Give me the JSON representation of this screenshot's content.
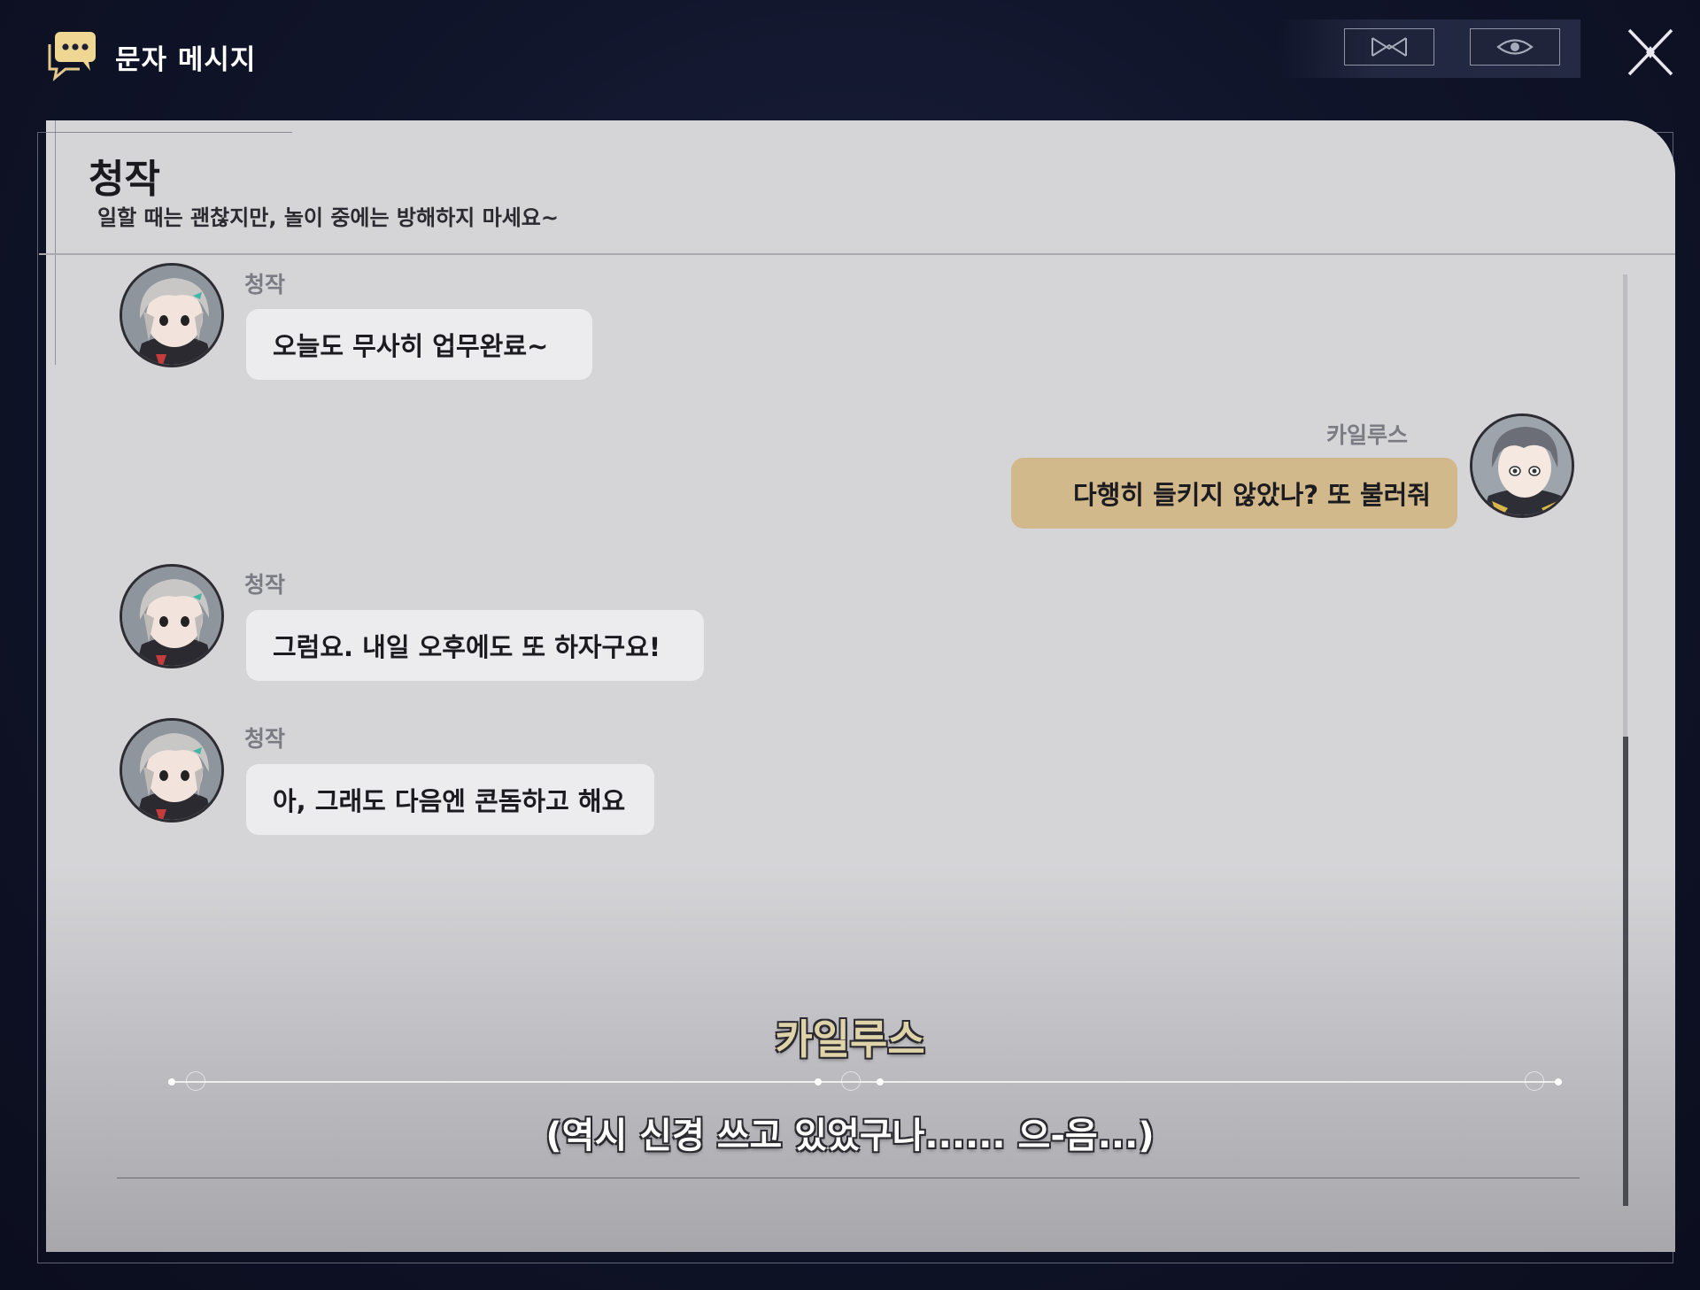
{
  "app": {
    "title": "문자 메시지",
    "icon": "chat-bubbles-icon"
  },
  "toolbar": {
    "mail_icon": "mail-icon",
    "eye_icon": "eye-icon",
    "close_icon": "close-icon"
  },
  "contact": {
    "name": "청작",
    "status": "일할 때는 괜찮지만, 놀이 중에는 방해하지 마세요~"
  },
  "messages": [
    {
      "side": "left",
      "sender": "청작",
      "text": "오늘도 무사히 업무완료~"
    },
    {
      "side": "right",
      "sender": "카일루스",
      "text": "다행히 들키지 않았나? 또 불러줘"
    },
    {
      "side": "left",
      "sender": "청작",
      "text": "그럼요. 내일 오후에도 또 하자구요!"
    },
    {
      "side": "left",
      "sender": "청작",
      "text": "아, 그래도 다음엔 콘돔하고 해요"
    }
  ],
  "dialogue": {
    "speaker": "카일루스",
    "line": "(역시 신경 쓰고 있었구나...... 으-음...)"
  },
  "colors": {
    "background": "#11152b",
    "panel": "#d5d5d8",
    "bubble_left": "#ececee",
    "bubble_right": "#d2b98b",
    "speaker_name": "#dfd3aa"
  }
}
